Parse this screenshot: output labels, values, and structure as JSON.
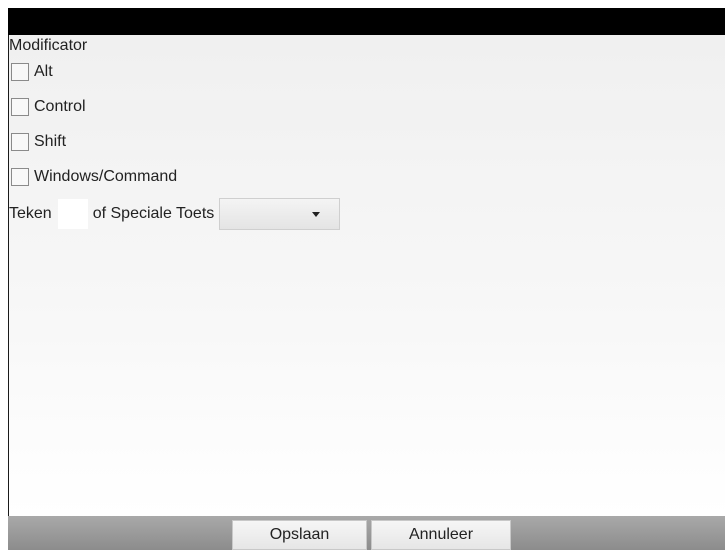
{
  "dialog": {
    "section_label": "Modificator",
    "modifiers": [
      {
        "label": "Alt",
        "checked": false
      },
      {
        "label": "Control",
        "checked": false
      },
      {
        "label": "Shift",
        "checked": false
      },
      {
        "label": "Windows/Command",
        "checked": false
      }
    ],
    "key_row": {
      "character_label": "Teken",
      "character_value": "",
      "special_key_label": "of Speciale Toets",
      "special_key_value": ""
    }
  },
  "footer": {
    "save_label": "Opslaan",
    "cancel_label": "Annuleer"
  },
  "colors": {
    "top_bar": "#000000",
    "footer_bar": "#9a9a9a",
    "dialog_background": "#f2f2f2"
  },
  "icons": {
    "special_key_dropdown": "caret-down-icon"
  }
}
